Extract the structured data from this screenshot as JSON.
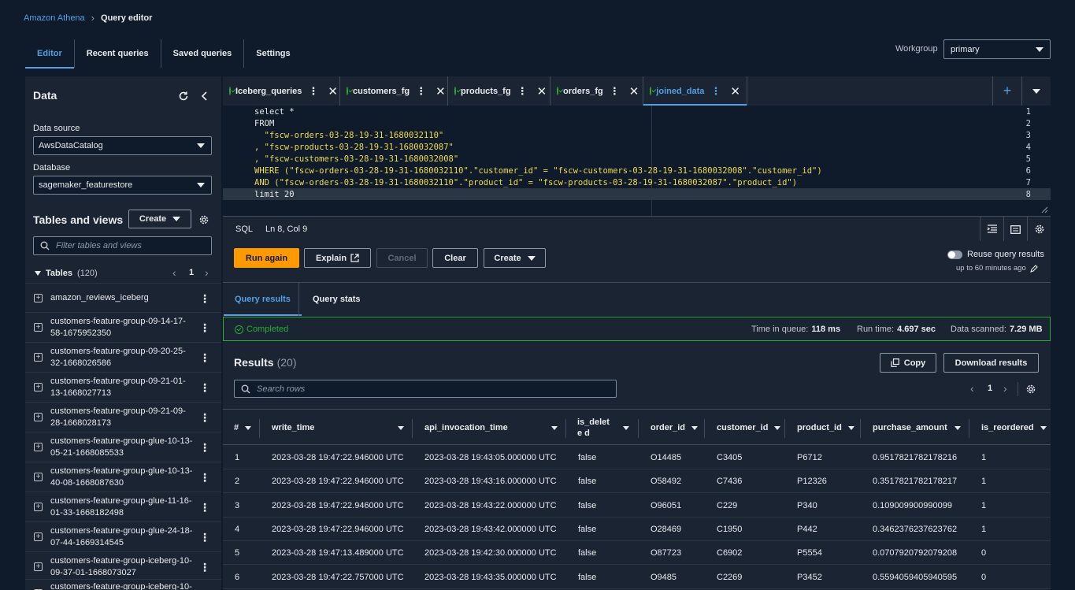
{
  "breadcrumb": {
    "root": "Amazon Athena",
    "current": "Query editor"
  },
  "main_tabs": [
    "Editor",
    "Recent queries",
    "Saved queries",
    "Settings"
  ],
  "workgroup": {
    "label": "Workgroup",
    "value": "primary"
  },
  "data_panel": {
    "title": "Data",
    "data_source_label": "Data source",
    "data_source_value": "AwsDataCatalog",
    "database_label": "Database",
    "database_value": "sagemaker_featurestore",
    "tables_views_title": "Tables and views",
    "create_label": "Create",
    "filter_placeholder": "Filter tables and views",
    "tables_header": "Tables",
    "tables_count": "(120)",
    "page": "1",
    "tables": [
      "amazon_reviews_iceberg",
      "customers-feature-group-09-14-17-58-1675952350",
      "customers-feature-group-09-20-25-32-1668026586",
      "customers-feature-group-09-21-01-13-1668027713",
      "customers-feature-group-09-21-09-28-1668028173",
      "customers-feature-group-glue-10-13-05-21-1668085533",
      "customers-feature-group-glue-10-13-40-08-1668087630",
      "customers-feature-group-glue-11-16-01-33-1668182498",
      "customers-feature-group-glue-24-18-07-44-1669314545",
      "customers-feature-group-iceberg-10-09-37-01-1668073027",
      "customers-feature-group-iceberg-10-"
    ]
  },
  "editor_tabs": [
    {
      "label": "Iceberg_queries",
      "active": false
    },
    {
      "label": "customers_fg",
      "active": false
    },
    {
      "label": "products_fg",
      "active": false
    },
    {
      "label": "orders_fg",
      "active": false
    },
    {
      "label": "joined_data",
      "active": true
    }
  ],
  "editor": {
    "lines": [
      [
        "select *"
      ],
      [
        "FROM"
      ],
      [
        "  \"fscw-orders-03-28-19-31-1680032110\""
      ],
      [
        ", \"fscw-products-03-28-19-31-1680032087\""
      ],
      [
        ", \"fscw-customers-03-28-19-31-1680032008\""
      ],
      [
        "WHERE (\"fscw-orders-03-28-19-31-1680032110\".\"customer_id\" = \"fscw-customers-03-28-19-31-1680032008\".\"customer_id\")"
      ],
      [
        "AND (\"fscw-orders-03-28-19-31-1680032110\".\"product_id\" = \"fscw-products-03-28-19-31-1680032087\".\"product_id\")"
      ],
      [
        "limit 20"
      ]
    ],
    "language": "SQL",
    "cursor": "Ln 8, Col 9"
  },
  "actions": {
    "run": "Run again",
    "explain": "Explain",
    "cancel": "Cancel",
    "clear": "Clear",
    "create": "Create",
    "reuse_label": "Reuse query results",
    "reuse_sub": "up to 60 minutes ago"
  },
  "result_tabs": [
    "Query results",
    "Query stats"
  ],
  "status": {
    "state": "Completed",
    "queue_label": "Time in queue:",
    "queue_value": "118 ms",
    "run_label": "Run time:",
    "run_value": "4.697 sec",
    "scan_label": "Data scanned:",
    "scan_value": "7.29 MB"
  },
  "results": {
    "title": "Results",
    "count": "(20)",
    "copy": "Copy",
    "download": "Download results",
    "search_placeholder": "Search rows",
    "page": "1",
    "columns": [
      "#",
      "write_time",
      "api_invocation_time",
      "is_delete d",
      "order_id",
      "customer_id",
      "product_id",
      "purchase_amount",
      "is_reordered"
    ],
    "rows": [
      [
        "1",
        "2023-03-28 19:47:22.946000 UTC",
        "2023-03-28 19:43:05.000000 UTC",
        "false",
        "O14485",
        "C3405",
        "P6712",
        "0.9517821782178216",
        "1"
      ],
      [
        "2",
        "2023-03-28 19:47:22.946000 UTC",
        "2023-03-28 19:43:16.000000 UTC",
        "false",
        "O58492",
        "C7436",
        "P12326",
        "0.3517821782178217",
        "1"
      ],
      [
        "3",
        "2023-03-28 19:47:22.946000 UTC",
        "2023-03-28 19:43:22.000000 UTC",
        "false",
        "O96051",
        "C229",
        "P340",
        "0.109009900990099",
        "1"
      ],
      [
        "4",
        "2023-03-28 19:47:22.946000 UTC",
        "2023-03-28 19:43:42.000000 UTC",
        "false",
        "O28469",
        "C1950",
        "P442",
        "0.3462376237623762",
        "1"
      ],
      [
        "5",
        "2023-03-28 19:47:13.489000 UTC",
        "2023-03-28 19:42:30.000000 UTC",
        "false",
        "O87723",
        "C6902",
        "P5554",
        "0.0707920792079208",
        "0"
      ],
      [
        "6",
        "2023-03-28 19:47:22.757000 UTC",
        "2023-03-28 19:43:35.000000 UTC",
        "false",
        "O9485",
        "C2269",
        "P3452",
        "0.5594059405940595",
        "0"
      ]
    ]
  }
}
